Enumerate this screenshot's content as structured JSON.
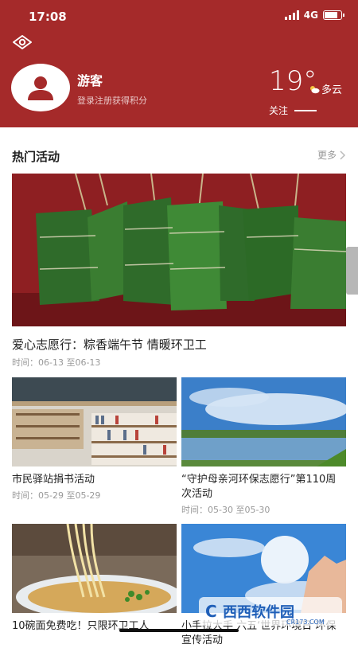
{
  "status": {
    "time": "17:08",
    "network": "4G",
    "battery_level": 0.85
  },
  "header": {
    "username": "游客",
    "login_hint": "登录注册获得积分",
    "weather": {
      "temp": "19°",
      "condition": "多云",
      "follow_label": "关注"
    }
  },
  "section": {
    "title": "热门活动",
    "more_label": "更多"
  },
  "hero": {
    "title": "爱心志愿行：粽香端午节  情暖环卫工",
    "time": "时间：06-13 至06-13"
  },
  "cards": [
    {
      "title": "市民驿站捐书活动",
      "time": "时间：05-29 至05-29"
    },
    {
      "title": "“守护母亲河环保志愿行”第110周次活动",
      "time": "时间：05-30 至05-30"
    },
    {
      "title": "10碗面免费吃！只限环卫工人",
      "time": ""
    },
    {
      "title": "小手拉大手 六五‘世界环境日’环保宣传活动",
      "time": ""
    }
  ],
  "watermark": {
    "text": "西西软件园",
    "url_text": "CR173.COM"
  },
  "colors": {
    "brand": "#a52a2a"
  }
}
